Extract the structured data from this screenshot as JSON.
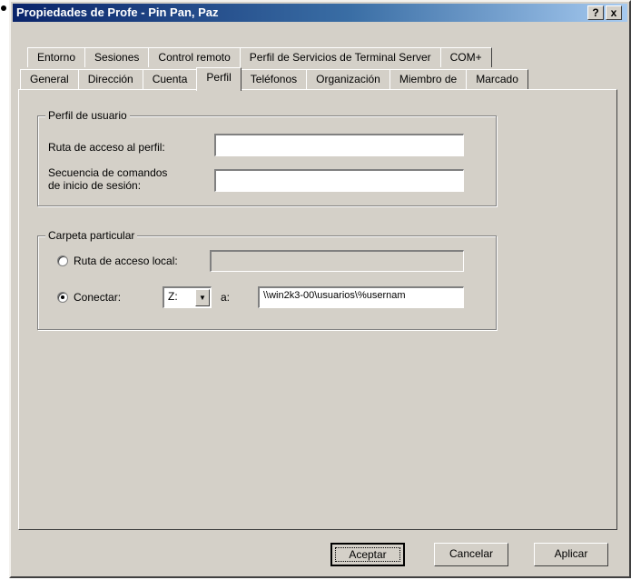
{
  "window": {
    "title": "Propiedades de Profe - Pin Pan, Paz",
    "help_label": "?",
    "close_label": "x"
  },
  "tabs": {
    "row1": [
      "Entorno",
      "Sesiones",
      "Control remoto",
      "Perfil de Servicios de Terminal Server",
      "COM+"
    ],
    "row2": [
      "General",
      "Dirección",
      "Cuenta",
      "Perfil",
      "Teléfonos",
      "Organización",
      "Miembro de",
      "Marcado"
    ],
    "active": "Perfil"
  },
  "perfil_usuario": {
    "legend": "Perfil de usuario",
    "ruta_label": "Ruta de acceso al perfil:",
    "ruta_value": "",
    "secuencia_label_1": "Secuencia de comandos",
    "secuencia_label_2": "de inicio de sesión:",
    "secuencia_value": ""
  },
  "carpeta_particular": {
    "legend": "Carpeta particular",
    "local_label": "Ruta de acceso local:",
    "local_value": "",
    "local_selected": false,
    "conectar_label": "Conectar:",
    "conectar_selected": true,
    "drive_value": "Z:",
    "a_label": "a:",
    "path_value": "\\\\win2k3-00\\usuarios\\%usernam"
  },
  "buttons": {
    "accept": "Aceptar",
    "cancel": "Cancelar",
    "apply": "Aplicar"
  }
}
